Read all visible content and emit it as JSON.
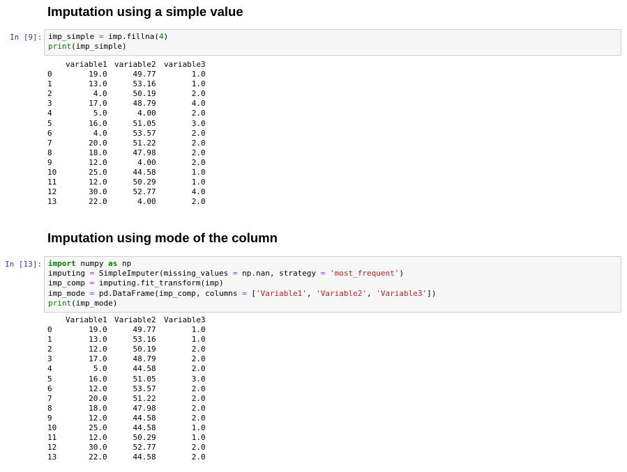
{
  "section1": {
    "heading": "Imputation using a simple value",
    "prompt": "In [9]:",
    "code": [
      [
        [
          "name",
          "imp_simple "
        ],
        [
          "op",
          "="
        ],
        [
          "name",
          " imp.fillna("
        ],
        [
          "num",
          "4"
        ],
        [
          "name",
          ")"
        ]
      ],
      [
        [
          "bi",
          "print"
        ],
        [
          "name",
          "(imp_simple)"
        ]
      ]
    ],
    "output": {
      "columns": [
        "variable1",
        "variable2",
        "variable3"
      ],
      "rows": [
        [
          "0",
          "19.0",
          "49.77",
          "1.0"
        ],
        [
          "1",
          "13.0",
          "53.16",
          "1.0"
        ],
        [
          "2",
          "4.0",
          "50.19",
          "2.0"
        ],
        [
          "3",
          "17.0",
          "48.79",
          "4.0"
        ],
        [
          "4",
          "5.0",
          "4.00",
          "2.0"
        ],
        [
          "5",
          "16.0",
          "51.05",
          "3.0"
        ],
        [
          "6",
          "4.0",
          "53.57",
          "2.0"
        ],
        [
          "7",
          "20.0",
          "51.22",
          "2.0"
        ],
        [
          "8",
          "18.0",
          "47.98",
          "2.0"
        ],
        [
          "9",
          "12.0",
          "4.00",
          "2.0"
        ],
        [
          "10",
          "25.0",
          "44.58",
          "1.0"
        ],
        [
          "11",
          "12.0",
          "50.29",
          "1.0"
        ],
        [
          "12",
          "30.0",
          "52.77",
          "4.0"
        ],
        [
          "13",
          "22.0",
          "4.00",
          "2.0"
        ]
      ]
    }
  },
  "section2": {
    "heading": "Imputation using mode of the column",
    "prompt": "In [13]:",
    "code": [
      [
        [
          "kw",
          "import"
        ],
        [
          "name",
          " numpy "
        ],
        [
          "kw",
          "as"
        ],
        [
          "name",
          " np"
        ]
      ],
      [
        [
          "name",
          "imputing "
        ],
        [
          "op",
          "="
        ],
        [
          "name",
          " SimpleImputer(missing_values "
        ],
        [
          "op",
          "="
        ],
        [
          "name",
          " np.nan, strategy "
        ],
        [
          "op",
          "="
        ],
        [
          "name",
          " "
        ],
        [
          "str",
          "'most_frequent'"
        ],
        [
          "name",
          ")"
        ]
      ],
      [
        [
          "name",
          "imp_comp "
        ],
        [
          "op",
          "="
        ],
        [
          "name",
          " imputing.fit_transform(imp)"
        ]
      ],
      [
        [
          "name",
          "imp_mode "
        ],
        [
          "op",
          "="
        ],
        [
          "name",
          " pd.DataFrame(imp_comp, columns "
        ],
        [
          "op",
          "="
        ],
        [
          "name",
          " ["
        ],
        [
          "str",
          "'Variable1'"
        ],
        [
          "name",
          ", "
        ],
        [
          "str",
          "'Variable2'"
        ],
        [
          "name",
          ", "
        ],
        [
          "str",
          "'Variable3'"
        ],
        [
          "name",
          "])"
        ]
      ],
      [
        [
          "bi",
          "print"
        ],
        [
          "name",
          "(imp_mode)"
        ]
      ]
    ],
    "output": {
      "columns": [
        "Variable1",
        "Variable2",
        "Variable3"
      ],
      "rows": [
        [
          "0",
          "19.0",
          "49.77",
          "1.0"
        ],
        [
          "1",
          "13.0",
          "53.16",
          "1.0"
        ],
        [
          "2",
          "12.0",
          "50.19",
          "2.0"
        ],
        [
          "3",
          "17.0",
          "48.79",
          "2.0"
        ],
        [
          "4",
          "5.0",
          "44.58",
          "2.0"
        ],
        [
          "5",
          "16.0",
          "51.05",
          "3.0"
        ],
        [
          "6",
          "12.0",
          "53.57",
          "2.0"
        ],
        [
          "7",
          "20.0",
          "51.22",
          "2.0"
        ],
        [
          "8",
          "18.0",
          "47.98",
          "2.0"
        ],
        [
          "9",
          "12.0",
          "44.58",
          "2.0"
        ],
        [
          "10",
          "25.0",
          "44.58",
          "1.0"
        ],
        [
          "11",
          "12.0",
          "50.29",
          "1.0"
        ],
        [
          "12",
          "30.0",
          "52.77",
          "2.0"
        ],
        [
          "13",
          "22.0",
          "44.58",
          "2.0"
        ]
      ]
    }
  },
  "colors": {
    "prompt": "#303f9f",
    "input_background": "#f7f7f7",
    "input_border": "#cfcfcf",
    "keyword": "#008000",
    "string": "#ba2121",
    "operator": "#aa22ff",
    "number": "#008000"
  }
}
